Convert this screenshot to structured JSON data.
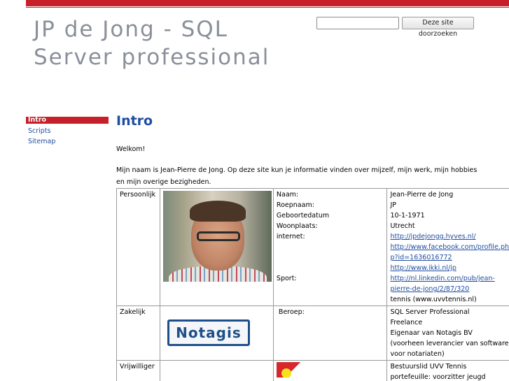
{
  "header": {
    "site_title": "JP de Jong - SQL Server professional",
    "search_button_label": "Deze site doorzoeken",
    "search_value": ""
  },
  "sidebar": {
    "items": [
      {
        "label": "Intro",
        "active": true
      },
      {
        "label": "Scripts",
        "active": false
      },
      {
        "label": "Sitemap",
        "active": false
      }
    ]
  },
  "main": {
    "heading": "Intro",
    "welcome": "Welkom!",
    "intro": "Mijn naam is Jean-Pierre de Jong. Op deze site kun je informatie vinden over mijzelf, mijn werk, mijn hobbies en mijn overige bezigheden.",
    "table": {
      "personal": {
        "section": "Persoonlijk",
        "labels": [
          "Naam:",
          "Roepnaam:",
          "Geboortedatum",
          "Woonplaats:",
          "internet:",
          "Sport:"
        ],
        "naam": "Jean-Pierre de Jong",
        "roepnaam": "JP",
        "geboortedatum": "10-1-1971",
        "woonplaats": "Utrecht",
        "links": [
          "http://jpdejongg.hyves.nl/",
          "http://www.facebook.com/profile.php?id=1636016772",
          "http://www.ikki.nl/jp",
          "http://nl.linkedin.com/pub/jean-pierre-de-jong/2/87/320"
        ],
        "sport": "tennis (www.uvvtennis.nl)"
      },
      "business": {
        "section": "Zakelijk",
        "logo_text": "Notagis",
        "label": "Beroep:",
        "lines": [
          "SQL Server Professional",
          "Freelance",
          "Eigenaar van Notagis BV",
          "(voorheen leverancier van software voor notariaten)"
        ]
      },
      "volunteer": {
        "section": "Vrijwilliger",
        "lines": [
          "Bestuurslid UVV Tennis",
          "portefeuille: voorzitter jeugd"
        ]
      }
    }
  }
}
